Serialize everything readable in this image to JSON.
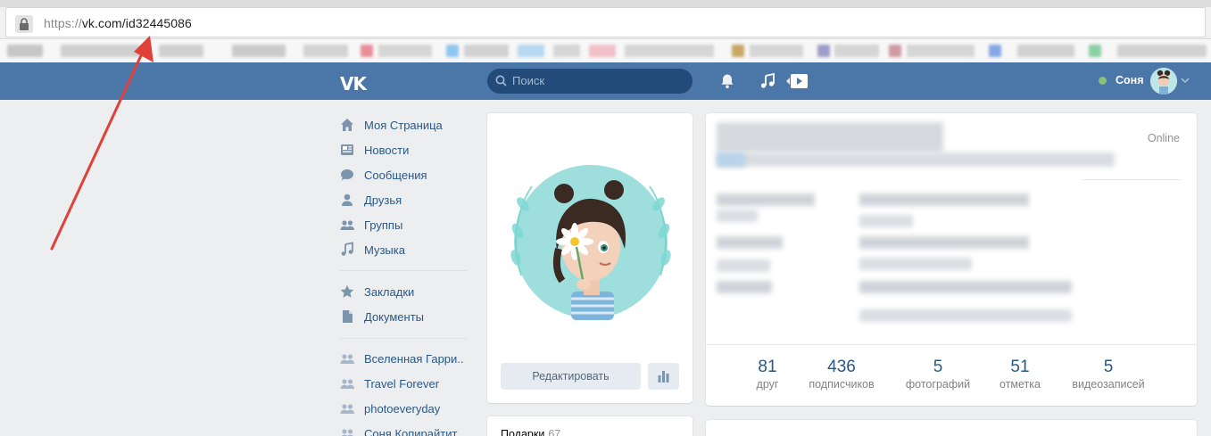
{
  "browser": {
    "url_protocol": "https://",
    "url_rest": "vk.com/id32445086"
  },
  "header": {
    "logo": "VK",
    "search_placeholder": "Поиск",
    "user_name": "Соня",
    "accent_color": "#4a76a8"
  },
  "sidebar": {
    "items": [
      {
        "label": "Моя Страница",
        "icon": "home-icon"
      },
      {
        "label": "Новости",
        "icon": "news-icon"
      },
      {
        "label": "Сообщения",
        "icon": "messages-icon"
      },
      {
        "label": "Друзья",
        "icon": "friends-icon"
      },
      {
        "label": "Группы",
        "icon": "groups-icon"
      },
      {
        "label": "Музыка",
        "icon": "music-icon"
      },
      {
        "label": "Закладки",
        "icon": "star-icon"
      },
      {
        "label": "Документы",
        "icon": "document-icon"
      },
      {
        "label": "Вселенная Гарри..",
        "icon": "group-icon"
      },
      {
        "label": "Travel Forever",
        "icon": "group-icon"
      },
      {
        "label": "photoeveryday",
        "icon": "group-icon"
      },
      {
        "label": "Соня Копирайтит",
        "icon": "group-icon"
      }
    ]
  },
  "profile": {
    "edit_label": "Редактировать",
    "gifts_label": "Подарки",
    "gifts_count": "67",
    "status": "Online"
  },
  "counters": [
    {
      "num": "81",
      "label": "друг"
    },
    {
      "num": "436",
      "label": "подписчиков"
    },
    {
      "num": "5",
      "label": "фотографий"
    },
    {
      "num": "51",
      "label": "отметка"
    },
    {
      "num": "5",
      "label": "видеозаписей"
    }
  ]
}
